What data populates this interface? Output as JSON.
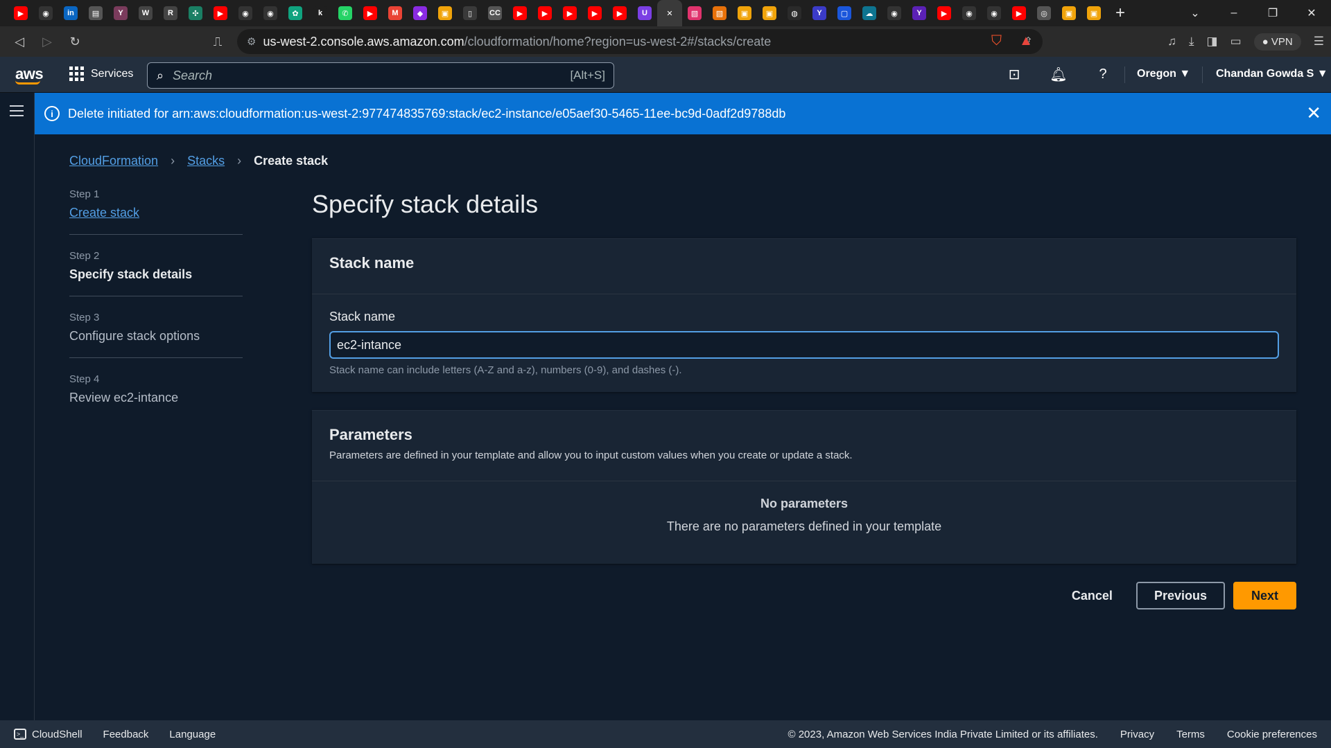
{
  "browser": {
    "tab_icons": [
      {
        "name": "youtube-icon",
        "color": "#ff0000",
        "glyph": "▶"
      },
      {
        "name": "github-icon",
        "color": "#333333",
        "glyph": "◉"
      },
      {
        "name": "linkedin-icon",
        "color": "#0a66c2",
        "glyph": "in"
      },
      {
        "name": "app-icon",
        "color": "#555555",
        "glyph": "▤"
      },
      {
        "name": "yc-icon",
        "color": "#7a3b5c",
        "glyph": "Y"
      },
      {
        "name": "w-icon",
        "color": "#444444",
        "glyph": "W"
      },
      {
        "name": "r-icon",
        "color": "#444444",
        "glyph": "R"
      },
      {
        "name": "puzzle-icon",
        "color": "#1a7f64",
        "glyph": "✣"
      },
      {
        "name": "youtube-icon",
        "color": "#ff0000",
        "glyph": "▶"
      },
      {
        "name": "github-icon",
        "color": "#333333",
        "glyph": "◉"
      },
      {
        "name": "github-icon",
        "color": "#333333",
        "glyph": "◉"
      },
      {
        "name": "chatgpt-icon",
        "color": "#10a37f",
        "glyph": "✿"
      },
      {
        "name": "k-icon",
        "color": "#1f1f1f",
        "glyph": "k"
      },
      {
        "name": "whatsapp-icon",
        "color": "#25d366",
        "glyph": "✆"
      },
      {
        "name": "youtube-icon",
        "color": "#ff0000",
        "glyph": "▶"
      },
      {
        "name": "gmail-icon",
        "color": "#ea4335",
        "glyph": "M"
      },
      {
        "name": "colorful-icon",
        "color": "#8a2be2",
        "glyph": "◆"
      },
      {
        "name": "box-icon",
        "color": "#f0a30a",
        "glyph": "▣"
      },
      {
        "name": "doc-icon",
        "color": "#3a3a3a",
        "glyph": "▯"
      },
      {
        "name": "cc-icon",
        "color": "#555555",
        "glyph": "CC"
      },
      {
        "name": "youtube-icon",
        "color": "#ff0000",
        "glyph": "▶"
      },
      {
        "name": "youtube-icon",
        "color": "#ff0000",
        "glyph": "▶"
      },
      {
        "name": "youtube-icon",
        "color": "#ff0000",
        "glyph": "▶"
      },
      {
        "name": "youtube-icon",
        "color": "#ff0000",
        "glyph": "▶"
      },
      {
        "name": "youtube-icon",
        "color": "#ff0000",
        "glyph": "▶"
      },
      {
        "name": "u-icon",
        "color": "#7b3fe4",
        "glyph": "U"
      },
      {
        "name": "close-tab-icon",
        "color": "transparent",
        "glyph": "✕",
        "active": true
      },
      {
        "name": "pink-icon",
        "color": "#e0336d",
        "glyph": "▧"
      },
      {
        "name": "orange-icon",
        "color": "#e8710a",
        "glyph": "▧"
      },
      {
        "name": "box-icon",
        "color": "#f0a30a",
        "glyph": "▣"
      },
      {
        "name": "box-icon",
        "color": "#f0a30a",
        "glyph": "▣"
      },
      {
        "name": "dark-icon",
        "color": "#2a2a2a",
        "glyph": "◍"
      },
      {
        "name": "fork-icon",
        "color": "#3b3bc8",
        "glyph": "Y"
      },
      {
        "name": "square-icon",
        "color": "#1a56db",
        "glyph": "▢"
      },
      {
        "name": "cloud-icon",
        "color": "#0e7490",
        "glyph": "☁"
      },
      {
        "name": "github-icon",
        "color": "#333333",
        "glyph": "◉"
      },
      {
        "name": "fork-icon",
        "color": "#5b21b6",
        "glyph": "Y"
      },
      {
        "name": "youtube-icon",
        "color": "#ff0000",
        "glyph": "▶"
      },
      {
        "name": "github-icon",
        "color": "#333333",
        "glyph": "◉"
      },
      {
        "name": "github-icon",
        "color": "#333333",
        "glyph": "◉"
      },
      {
        "name": "youtube-icon",
        "color": "#ff0000",
        "glyph": "▶"
      },
      {
        "name": "globe-icon",
        "color": "#555555",
        "glyph": "◎"
      },
      {
        "name": "box-icon",
        "color": "#f0a30a",
        "glyph": "▣"
      },
      {
        "name": "box-icon",
        "color": "#f0a30a",
        "glyph": "▣"
      }
    ],
    "url_host": "us-west-2.console.aws.amazon.com",
    "url_path": "/cloudformation/home?region=us-west-2#/stacks/create",
    "vpn_label": "VPN"
  },
  "aws_nav": {
    "logo": "aws",
    "services_label": "Services",
    "search_placeholder": "Search",
    "search_shortcut": "[Alt+S]",
    "region": "Oregon ▼",
    "user": "Chandan Gowda S ▼"
  },
  "flash": {
    "message": "Delete initiated for arn:aws:cloudformation:us-west-2:977474835769:stack/ec2-instance/e05aef30-5465-11ee-bc9d-0adf2d9788db",
    "color": "#0972d3"
  },
  "breadcrumb": {
    "items": [
      "CloudFormation",
      "Stacks"
    ],
    "current": "Create stack"
  },
  "steps": [
    {
      "num": "Step 1",
      "label": "Create stack"
    },
    {
      "num": "Step 2",
      "label": "Specify stack details"
    },
    {
      "num": "Step 3",
      "label": "Configure stack options"
    },
    {
      "num": "Step 4",
      "label": "Review ec2-intance"
    }
  ],
  "main": {
    "title": "Specify stack details",
    "stack_name_section": {
      "header": "Stack name",
      "field_label": "Stack name",
      "value": "ec2-intance",
      "hint": "Stack name can include letters (A-Z and a-z), numbers (0-9), and dashes (-)."
    },
    "parameters_section": {
      "header": "Parameters",
      "description": "Parameters are defined in your template and allow you to input custom values when you create or update a stack.",
      "empty_title": "No parameters",
      "empty_text": "There are no parameters defined in your template"
    }
  },
  "actions": {
    "cancel": "Cancel",
    "previous": "Previous",
    "next": "Next",
    "primary_color": "#ff9900"
  },
  "footer": {
    "cloudshell": "CloudShell",
    "feedback": "Feedback",
    "language": "Language",
    "copyright": "© 2023, Amazon Web Services India Private Limited or its affiliates.",
    "privacy": "Privacy",
    "terms": "Terms",
    "cookies": "Cookie preferences"
  }
}
